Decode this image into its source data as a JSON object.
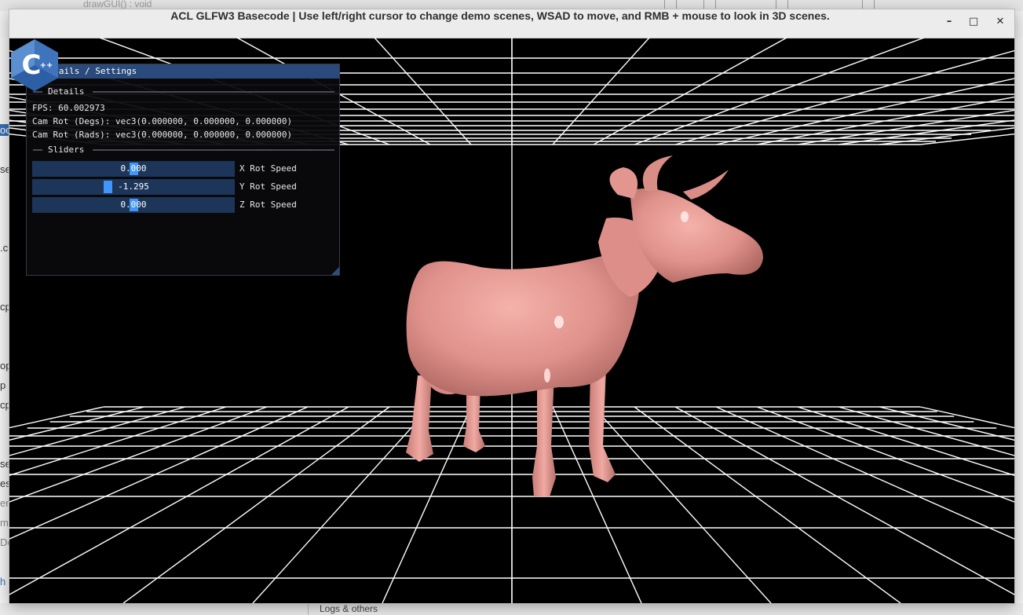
{
  "background": {
    "topbar_text": "drawGUI() : void",
    "left_fragments": [
      "oc",
      "se",
      ".c",
      "cp",
      "op",
      "p",
      "cp",
      "se",
      "es",
      "en",
      "m",
      "De",
      "h"
    ],
    "logs_label": "Logs & others"
  },
  "window": {
    "title": "ACL GLFW3 Basecode | Use left/right cursor to change demo scenes, WSAD to move, and RMB + mouse to look in 3D scenes.",
    "minimize_glyph": "–",
    "maximize_glyph": "□",
    "close_glyph": "✕"
  },
  "panel": {
    "title": "Details / Settings",
    "collapse_glyph": "▼",
    "details_header": "Details",
    "fps": "FPS: 60.002973",
    "cam_rot_degs": "Cam Rot (Degs): vec3(0.000000, 0.000000, 0.000000)",
    "cam_rot_rads": "Cam Rot (Rads): vec3(0.000000, 0.000000, 0.000000)",
    "sliders_header": "Sliders",
    "sliders": [
      {
        "value": "0.000",
        "label": "X Rot Speed",
        "level": 0.5
      },
      {
        "value": "-1.295",
        "label": "Y Rot Speed",
        "level": 0.37
      },
      {
        "value": "0.000",
        "label": "Z Rot Speed",
        "level": 0.5
      }
    ]
  },
  "logo": {
    "text": "C",
    "suffix": "++",
    "color": "#3e7fcb"
  },
  "colors": {
    "cow": "#e39690",
    "grid": "#ffffff",
    "panel_header": "#294a7a",
    "slider_grab": "#4296fa"
  }
}
